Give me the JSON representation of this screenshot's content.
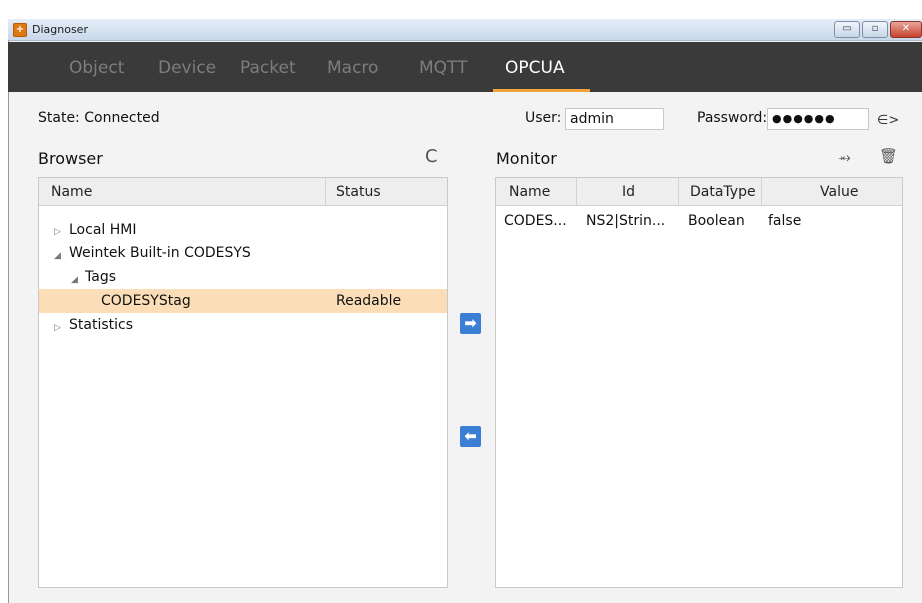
{
  "window": {
    "title": "Diagnoser",
    "controls": {
      "minimize": "▭",
      "maximize": "▫",
      "close": "✕"
    }
  },
  "tabs": [
    {
      "label": "Object",
      "active": false
    },
    {
      "label": "Device",
      "active": false
    },
    {
      "label": "Packet",
      "active": false
    },
    {
      "label": "Macro",
      "active": false
    },
    {
      "label": "MQTT",
      "active": false
    },
    {
      "label": "OPCUA",
      "active": true
    }
  ],
  "status": {
    "state_text": "State: Connected"
  },
  "login": {
    "user_label": "User:",
    "user_value": "admin",
    "password_label": "Password:",
    "password_value": "●●●●●●",
    "logout_icon": "∈>"
  },
  "browser": {
    "title": "Browser",
    "refresh_icon": "C",
    "columns": {
      "name": "Name",
      "status": "Status"
    },
    "tree": [
      {
        "arrow": "▷",
        "label": "Local HMI",
        "status": ""
      },
      {
        "arrow": "◢",
        "label": "Weintek Built-in CODESYS",
        "status": ""
      },
      {
        "arrow": "◢",
        "label": "Tags",
        "status": ""
      },
      {
        "arrow": "",
        "label": "CODESYStag",
        "status": "Readable"
      },
      {
        "arrow": "▷",
        "label": "Statistics",
        "status": ""
      }
    ]
  },
  "transfer": {
    "add_icon": "➡",
    "remove_icon": "⬅"
  },
  "monitor": {
    "title": "Monitor",
    "clear_icon": "⥇",
    "delete_icon": "🗑",
    "columns": {
      "name": "Name",
      "id": "Id",
      "datatype": "DataType",
      "value": "Value"
    },
    "rows": [
      {
        "name": "CODES...",
        "id": "NS2|Strin...",
        "datatype": "Boolean",
        "value": "false"
      }
    ]
  },
  "colors": {
    "accent": "#f0a23c",
    "tabbar": "#3a3a3a",
    "selection": "#fbdeb8",
    "button_blue": "#3b7fd4"
  }
}
